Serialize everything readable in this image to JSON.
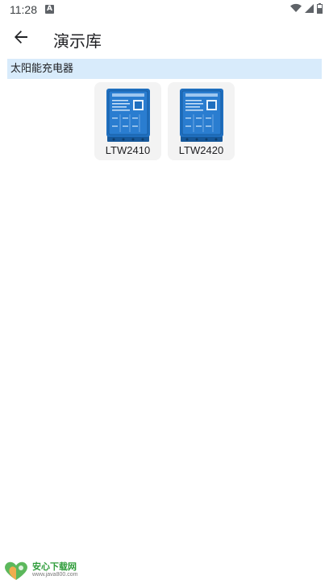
{
  "status_bar": {
    "time": "11:28",
    "notification_icon": "A",
    "icons": [
      "wifi-icon",
      "signal-icon",
      "battery-icon"
    ]
  },
  "app_bar": {
    "back_icon": "arrow-back-icon",
    "title": "演示库"
  },
  "section": {
    "title": "太阳能充电器"
  },
  "products": [
    {
      "label": "LTW2410",
      "icon": "device-image"
    },
    {
      "label": "LTW2420",
      "icon": "device-image"
    }
  ],
  "watermark": {
    "title": "安心下载网",
    "url": "www.java800.com"
  },
  "colors": {
    "section_bg": "#d8ebfb",
    "card_bg": "#f3f3f3",
    "device_blue": "#1f6fbf",
    "watermark_green": "#2e9c3a"
  }
}
